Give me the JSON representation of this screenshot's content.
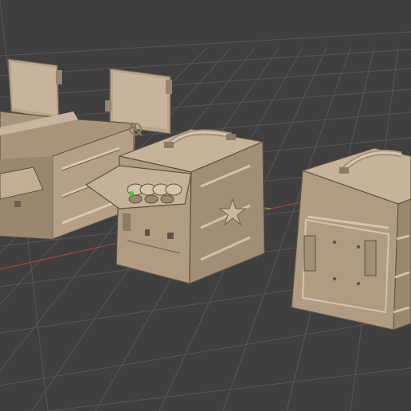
{
  "viewport": {
    "background": "#3f3f3f",
    "grid_color": "#555555",
    "x_axis_color": "#c9503c",
    "y_axis_color": "#6fae3a",
    "model_fill": "#b8a68f",
    "model_shade": "#8c7b66",
    "model_dark": "#5e5142",
    "model_light": "#d6c6ae"
  },
  "objects": [
    {
      "name": "ammo-box-open-large"
    },
    {
      "name": "ammo-box-with-belt"
    },
    {
      "name": "ammo-box-closed"
    }
  ],
  "origin_marker": {
    "name": "origin-dot",
    "color": "#34d13a"
  }
}
